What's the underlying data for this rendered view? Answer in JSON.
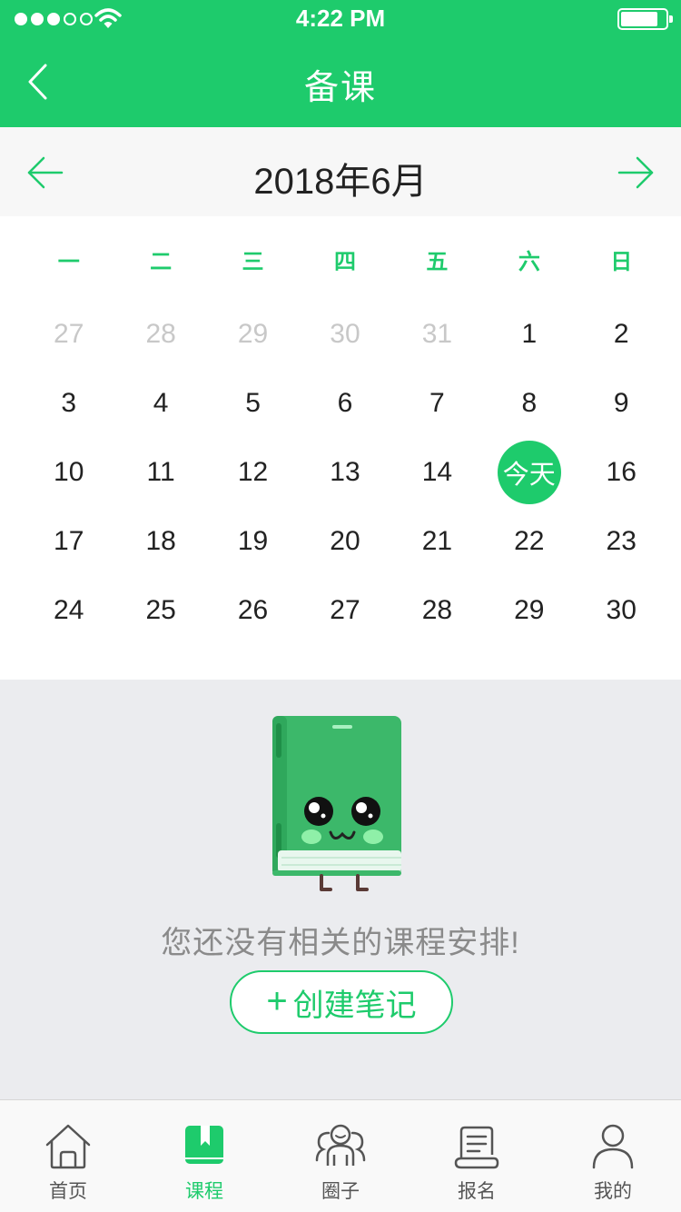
{
  "status_bar": {
    "time": "4:22 PM",
    "signal_bars": 3,
    "signal_total": 5,
    "battery_level": 0.8
  },
  "nav": {
    "title": "备课",
    "back_icon": "chevron-left-icon"
  },
  "month": {
    "title": "2018年6月",
    "prev_icon": "arrow-left-icon",
    "next_icon": "arrow-right-icon"
  },
  "calendar": {
    "weekdays": [
      "一",
      "二",
      "三",
      "四",
      "五",
      "六",
      "日"
    ],
    "days": [
      {
        "label": "27",
        "muted": true
      },
      {
        "label": "28",
        "muted": true
      },
      {
        "label": "29",
        "muted": true
      },
      {
        "label": "30",
        "muted": true
      },
      {
        "label": "31",
        "muted": true
      },
      {
        "label": "1"
      },
      {
        "label": "2"
      },
      {
        "label": "3"
      },
      {
        "label": "4"
      },
      {
        "label": "5"
      },
      {
        "label": "6"
      },
      {
        "label": "7"
      },
      {
        "label": "8"
      },
      {
        "label": "9"
      },
      {
        "label": "10"
      },
      {
        "label": "11"
      },
      {
        "label": "12"
      },
      {
        "label": "13"
      },
      {
        "label": "14"
      },
      {
        "label": "今天",
        "today": true
      },
      {
        "label": "16"
      },
      {
        "label": "17"
      },
      {
        "label": "18"
      },
      {
        "label": "19"
      },
      {
        "label": "20"
      },
      {
        "label": "21"
      },
      {
        "label": "22"
      },
      {
        "label": "23"
      },
      {
        "label": "24"
      },
      {
        "label": "25"
      },
      {
        "label": "26"
      },
      {
        "label": "27"
      },
      {
        "label": "28"
      },
      {
        "label": "29"
      },
      {
        "label": "30"
      }
    ]
  },
  "empty_state": {
    "message": "您还没有相关的课程安排!",
    "button_plus": "+",
    "button_label": "创建笔记",
    "illustration": "book-mascot-icon"
  },
  "tabs": [
    {
      "label": "首页",
      "icon": "home-icon",
      "active": false
    },
    {
      "label": "课程",
      "icon": "bookmark-book-icon",
      "active": true
    },
    {
      "label": "圈子",
      "icon": "group-icon",
      "active": false
    },
    {
      "label": "报名",
      "icon": "scroll-icon",
      "active": false
    },
    {
      "label": "我的",
      "icon": "person-icon",
      "active": false
    }
  ],
  "colors": {
    "accent": "#1ecb6c",
    "text": "#222222",
    "muted": "#c8c8c8",
    "background": "#ebecef"
  }
}
